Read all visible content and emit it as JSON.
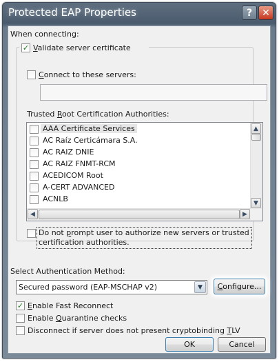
{
  "window": {
    "title": "Protected EAP Properties",
    "help_glyph": "?",
    "close_glyph": "✕"
  },
  "when_connecting": {
    "label": "When connecting:",
    "validate_cert": {
      "pre": "",
      "mnemonic": "V",
      "post": "alidate server certificate",
      "checked": true
    },
    "connect_servers": {
      "pre": "",
      "mnemonic": "C",
      "post": "onnect to these servers:",
      "checked": false
    },
    "servers_value": "",
    "trusted_label": {
      "pre": "Trusted ",
      "mnemonic": "R",
      "post": "oot Certification Authorities:"
    },
    "authorities": [
      {
        "name": "AAA Certificate Services",
        "checked": false,
        "selected": true
      },
      {
        "name": "AC Raíz Certicámara S.A.",
        "checked": false,
        "selected": false
      },
      {
        "name": "AC RAIZ DNIE",
        "checked": false,
        "selected": false
      },
      {
        "name": "AC RAIZ FNMT-RCM",
        "checked": false,
        "selected": false
      },
      {
        "name": "ACEDICOM Root",
        "checked": false,
        "selected": false
      },
      {
        "name": "A-CERT ADVANCED",
        "checked": false,
        "selected": false
      },
      {
        "name": "ACNLB",
        "checked": false,
        "selected": false
      }
    ],
    "no_prompt": {
      "line1_pre": "Do not ",
      "line1_mnemonic": "p",
      "line1_post": "rompt user to authorize new servers or trusted",
      "line2": "certification authorities.",
      "checked": false
    }
  },
  "auth_method": {
    "label": "Select Authentication Method:",
    "selected": "Secured password (EAP-MSCHAP v2)",
    "configure": {
      "mnemonic": "C",
      "post": "onfigure..."
    }
  },
  "options": {
    "fast_reconnect": {
      "mnemonic": "E",
      "post": "nable Fast Reconnect",
      "checked": true
    },
    "quarantine": {
      "pre": "Enable ",
      "mnemonic": "Q",
      "post": "uarantine checks",
      "checked": false
    },
    "cryptobinding": {
      "pre": "Disconnect if server does not present cryptobinding ",
      "mnemonic": "T",
      "post": "LV",
      "checked": false
    }
  },
  "buttons": {
    "ok": "OK",
    "cancel": "Cancel"
  },
  "icons": {
    "check": "✓",
    "arrow_up": "▲",
    "arrow_down": "▼",
    "arrow_left": "◀",
    "arrow_right": "▶"
  },
  "colors": {
    "accent": "#3c7fb1",
    "close": "#c6381f",
    "check": "#227722"
  }
}
